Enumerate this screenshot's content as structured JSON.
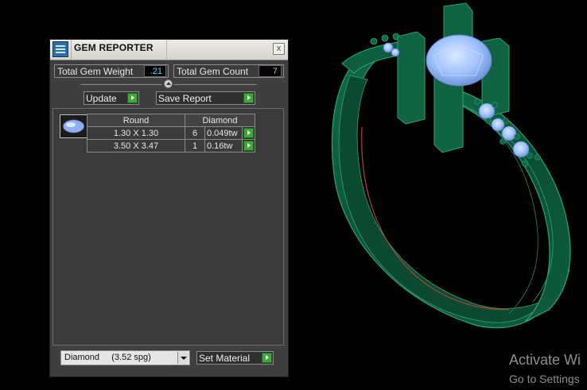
{
  "panel": {
    "title": "GEM REPORTER",
    "close_glyph": "x",
    "total_weight_label": "Total Gem Weight",
    "total_weight_value": ".21",
    "total_count_label": "Total Gem Count",
    "total_count_value": "7",
    "update_label": "Update",
    "save_report_label": "Save Report",
    "table": {
      "headers": [
        "Round",
        "Diamond"
      ],
      "rows": [
        {
          "size": "1.30 X 1.30",
          "count": "6",
          "weight": "0.049tw"
        },
        {
          "size": "3.50 X 3.47",
          "count": "1",
          "weight": "0.16tw"
        }
      ]
    },
    "material_select": "Diamond     (3.52 spg)",
    "set_material_label": "Set Material"
  },
  "watermark": {
    "line1": "Activate Wi",
    "line2": "Go to Settings"
  },
  "colors": {
    "ring_green": "#0d5a3a",
    "ring_edge": "#2aa574",
    "gem_blue": "#9fc2ff",
    "button_green": "#3ea83a",
    "value_cyan": "#5fd7ff"
  },
  "icons": [
    "gem-reporter-icon",
    "close-icon",
    "collapse-icon",
    "play-arrow-icon",
    "dropdown-arrow-icon",
    "round-gem-icon"
  ]
}
